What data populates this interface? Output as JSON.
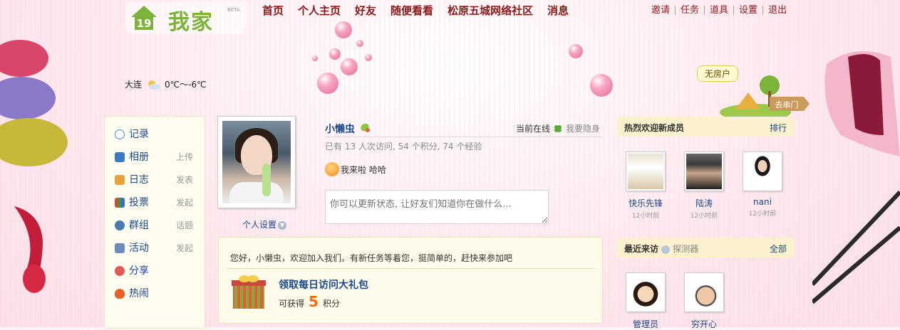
{
  "brand": {
    "name": "我家",
    "badge": "19",
    "tag": "BETA"
  },
  "nav": [
    "首页",
    "个人主页",
    "好友",
    "随便看看",
    "松原五城网络社区",
    "消息"
  ],
  "top_links": [
    "邀请",
    "任务",
    "道具",
    "设置",
    "退出"
  ],
  "weather": {
    "city": "大连",
    "temp": "0℃～-6℃",
    "icon": "cloudy-icon"
  },
  "house": {
    "label": "无房户",
    "sign": "去串门"
  },
  "sidebar": [
    {
      "label": "记录",
      "action": "",
      "icon": "record-icon",
      "color": "#4a8ad8"
    },
    {
      "label": "相册",
      "action": "上传",
      "icon": "album-icon",
      "color": "#3a7ac0"
    },
    {
      "label": "日志",
      "action": "发表",
      "icon": "blog-icon",
      "color": "#e8a23a"
    },
    {
      "label": "投票",
      "action": "发起",
      "icon": "vote-icon",
      "color": "#d94a3a"
    },
    {
      "label": "群组",
      "action": "话题",
      "icon": "group-icon",
      "color": "#4a7ab0"
    },
    {
      "label": "活动",
      "action": "发起",
      "icon": "event-icon",
      "color": "#6a8ac0"
    },
    {
      "label": "分享",
      "action": "",
      "icon": "share-icon",
      "color": "#e05a5a"
    },
    {
      "label": "热闹",
      "action": "",
      "icon": "fire-icon",
      "color": "#e8602a"
    }
  ],
  "profile": {
    "username": "小懒虫",
    "online": "当前在线",
    "hide": "我要隐身",
    "stats": "已有 13 人次访问, 54 个积分, 74 个经验",
    "mood": "我来啦 哈哈",
    "status_placeholder": "你可以更新状态, 让好友们知道你在做什么...",
    "settings": "个人设置"
  },
  "welcome": {
    "text": "您好，小懒虫，欢迎加入我们。有新任务等着您，挺简单的，赶快来参加吧",
    "gift_title": "领取每日访问大礼包",
    "gift_prefix": "可获得",
    "gift_points": "5",
    "gift_unit": "积分"
  },
  "new_members": {
    "title": "热烈欢迎新成员",
    "link": "排行",
    "items": [
      {
        "name": "快乐先锋",
        "time": "12小时前"
      },
      {
        "name": "陆涛",
        "time": "12小时前"
      },
      {
        "name": "nani",
        "time": "12小时前"
      }
    ]
  },
  "recent_visits": {
    "title": "最近来访",
    "sub": "探测器",
    "link": "全部",
    "items": [
      {
        "name": "管理员"
      },
      {
        "name": "穷开心"
      }
    ]
  },
  "colors": {
    "link": "#1a4a8a",
    "nav": "#8a1a1a",
    "accent": "#ff6a00",
    "brand": "#7cb33a"
  }
}
